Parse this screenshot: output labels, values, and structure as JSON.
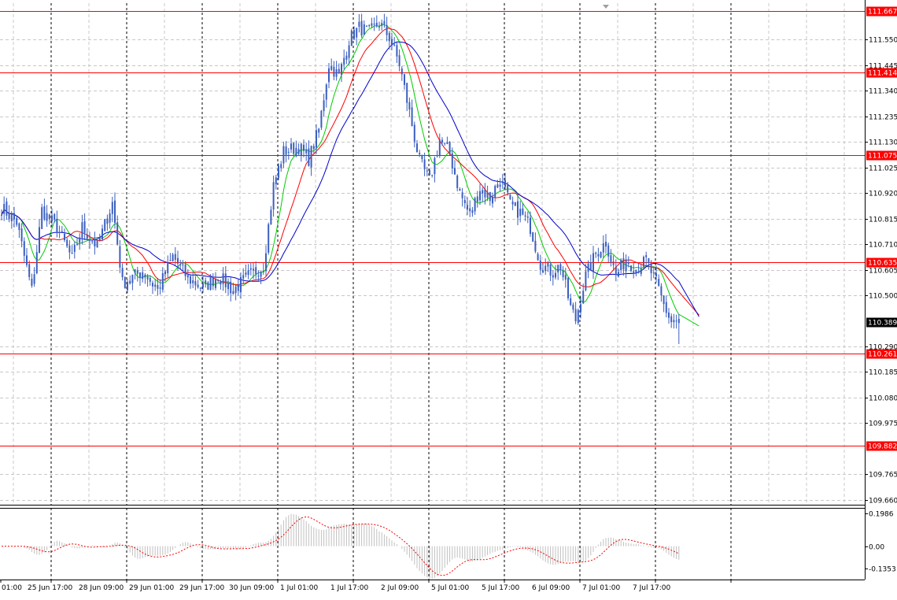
{
  "chart_data": [
    {
      "type": "candlestick",
      "title": "",
      "x_labels": [
        "01:00",
        "25 Jun 17:00",
        "28 Jun 09:00",
        "29 Jun 01:00",
        "29 Jun 17:00",
        "30 Jun 09:00",
        "1 Jul 01:00",
        "1 Jul 17:00",
        "2 Jul 09:00",
        "5 Jul 01:00",
        "5 Jul 17:00",
        "6 Jul 09:00",
        "7 Jul 01:00",
        "7 Jul 17:00"
      ],
      "y_ticks": [
        "111.550",
        "111.445",
        "111.340",
        "111.235",
        "111.130",
        "111.025",
        "110.920",
        "110.815",
        "110.710",
        "110.605",
        "110.500",
        "110.290",
        "110.185",
        "110.080",
        "109.975",
        "109.765",
        "109.660"
      ],
      "ylim": [
        109.64,
        111.7
      ],
      "current_price": "110.389",
      "grid": true,
      "horizontal_levels": [
        {
          "value": 111.667,
          "label": "111.667",
          "color": "#ff0000"
        },
        {
          "value": 111.414,
          "label": "111.414",
          "color": "#ff0000"
        },
        {
          "value": 111.075,
          "label": "111.075",
          "color": "#ff0000"
        },
        {
          "value": 110.635,
          "label": "110.635",
          "color": "#ff0000"
        },
        {
          "value": 110.261,
          "label": "110.261",
          "color": "#ff0000"
        },
        {
          "value": 109.882,
          "label": "109.882",
          "color": "#ff0000"
        }
      ],
      "close_anchors": [
        [
          0,
          110.86
        ],
        [
          6,
          110.8
        ],
        [
          12,
          110.52
        ],
        [
          16,
          110.85
        ],
        [
          22,
          110.78
        ],
        [
          28,
          110.65
        ],
        [
          32,
          110.78
        ],
        [
          38,
          110.7
        ],
        [
          44,
          110.88
        ],
        [
          48,
          110.55
        ],
        [
          56,
          110.6
        ],
        [
          62,
          110.52
        ],
        [
          68,
          110.66
        ],
        [
          74,
          110.57
        ],
        [
          80,
          110.53
        ],
        [
          86,
          110.58
        ],
        [
          92,
          110.52
        ],
        [
          98,
          110.58
        ],
        [
          104,
          110.62
        ],
        [
          108,
          110.95
        ],
        [
          112,
          111.09
        ],
        [
          118,
          111.11
        ],
        [
          122,
          111.06
        ],
        [
          126,
          111.18
        ],
        [
          130,
          111.45
        ],
        [
          134,
          111.4
        ],
        [
          138,
          111.55
        ],
        [
          142,
          111.6
        ],
        [
          146,
          111.58
        ],
        [
          150,
          111.62
        ],
        [
          154,
          111.56
        ],
        [
          158,
          111.45
        ],
        [
          162,
          111.25
        ],
        [
          166,
          111.05
        ],
        [
          170,
          110.97
        ],
        [
          174,
          111.14
        ],
        [
          178,
          111.08
        ],
        [
          182,
          110.92
        ],
        [
          186,
          110.83
        ],
        [
          190,
          110.94
        ],
        [
          194,
          110.9
        ],
        [
          198,
          110.98
        ],
        [
          202,
          110.87
        ],
        [
          206,
          110.84
        ],
        [
          210,
          110.78
        ],
        [
          214,
          110.63
        ],
        [
          218,
          110.6
        ],
        [
          222,
          110.62
        ],
        [
          226,
          110.45
        ],
        [
          228,
          110.4
        ],
        [
          232,
          110.58
        ],
        [
          236,
          110.67
        ],
        [
          240,
          110.72
        ],
        [
          244,
          110.58
        ],
        [
          248,
          110.65
        ],
        [
          252,
          110.61
        ],
        [
          256,
          110.64
        ],
        [
          260,
          110.55
        ],
        [
          263,
          110.46
        ],
        [
          266,
          110.39
        ]
      ],
      "series": [
        {
          "name": "",
          "color": "#00cc00",
          "values_desc": "fast moving average",
          "period": 8
        },
        {
          "name": "",
          "color": "#ff0000",
          "values_desc": "medium moving average",
          "period": 16
        },
        {
          "name": "",
          "color": "#0000cc",
          "values_desc": "slow moving average",
          "period": 28
        }
      ]
    },
    {
      "type": "bar",
      "title": "",
      "y_ticks": [
        "0.1986",
        "0.00",
        "-0.1353"
      ],
      "ylim": [
        -0.2,
        0.23
      ],
      "histogram_color": "#c0c0c0",
      "signal_color": "#ff0000"
    }
  ]
}
